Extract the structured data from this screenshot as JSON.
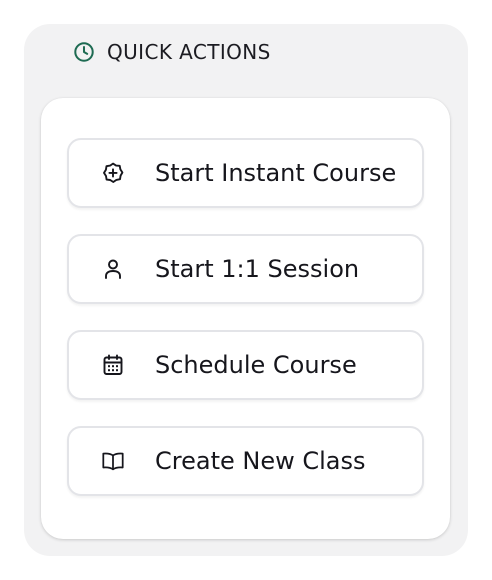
{
  "panel": {
    "title": "QUICK ACTIONS",
    "title_icon": "clock-icon",
    "accent_color": "#1e6b52"
  },
  "actions": [
    {
      "label": "Start Instant Course",
      "icon": "plus-badge-icon"
    },
    {
      "label": "Start 1:1 Session",
      "icon": "user-icon"
    },
    {
      "label": "Schedule Course",
      "icon": "calendar-icon"
    },
    {
      "label": "Create New Class",
      "icon": "open-book-icon"
    }
  ]
}
